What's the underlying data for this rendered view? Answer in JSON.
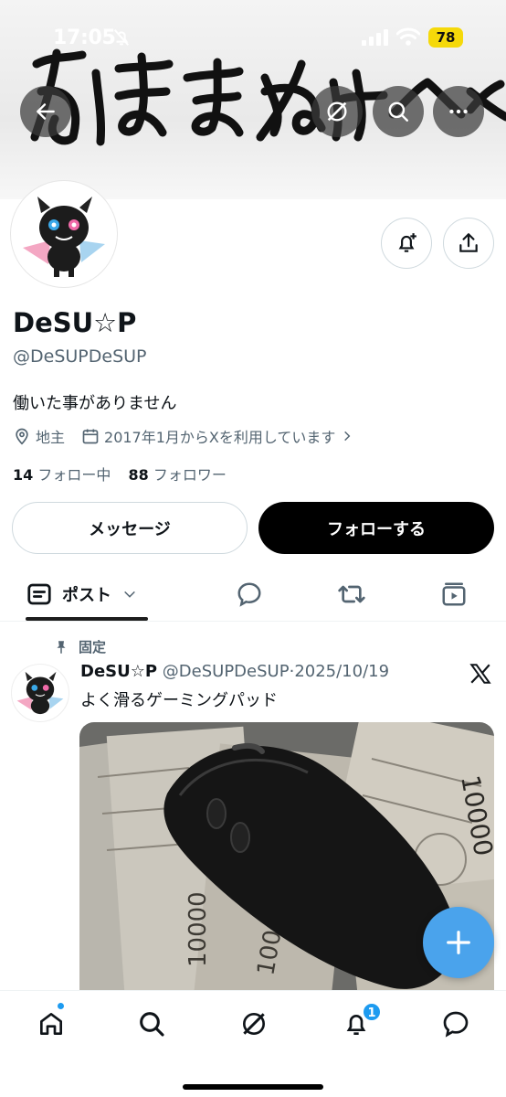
{
  "status": {
    "time": "17:05",
    "battery": "78"
  },
  "header": {
    "back_icon": "arrow-left-icon",
    "grok_icon": "grok-icon",
    "search_icon": "search-icon",
    "more_icon": "more-horizontal-icon",
    "banner_text": "女ほまぬけ^^"
  },
  "profile": {
    "name": "DeSU☆P",
    "handle": "@DeSUPDeSUP",
    "bio": "働いた事がありません",
    "location": "地主",
    "joined": "2017年1月からXを利用しています",
    "following_count": "14",
    "following_label": "フォロー中",
    "followers_count": "88",
    "followers_label": "フォロワー",
    "message_label": "メッセージ",
    "follow_label": "フォローする"
  },
  "tabs": {
    "post_label": "ポスト"
  },
  "pinned_post": {
    "pinned_label": "固定",
    "author": "DeSU☆P",
    "handle": "@DeSUPDeSUP",
    "date": "2025/10/19",
    "text": "よく滑るゲーミングパッド",
    "image_banknote_text": "10000"
  },
  "bottom_nav": {
    "notification_count": "1"
  },
  "colors": {
    "accent": "#1d9bf0",
    "fab": "#4aa3ec",
    "follow_button": "#000000"
  }
}
